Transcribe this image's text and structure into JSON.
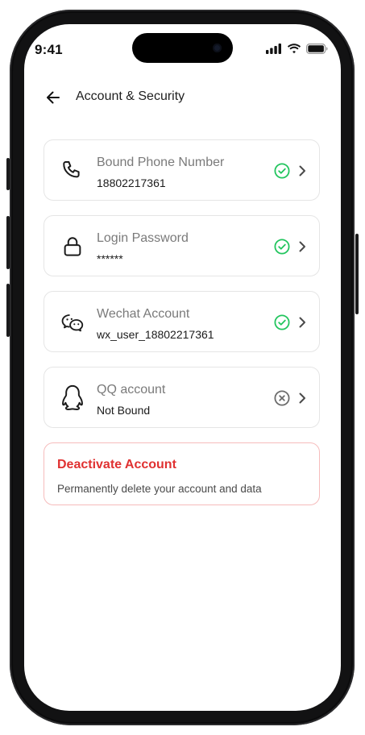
{
  "status_bar": {
    "time": "9:41"
  },
  "header": {
    "back_icon": "arrow-left-icon",
    "title": "Account & Security"
  },
  "items": [
    {
      "icon": "phone-icon",
      "label": "Bound Phone Number",
      "value": "18802217361",
      "status": "verified"
    },
    {
      "icon": "lock-icon",
      "label": "Login Password",
      "value": "******",
      "status": "verified"
    },
    {
      "icon": "wechat-icon",
      "label": "Wechat Account",
      "value": "wx_user_18802217361",
      "status": "verified"
    },
    {
      "icon": "qq-icon",
      "label": "QQ account",
      "value": "Not Bound",
      "status": "unbound"
    }
  ],
  "danger": {
    "title": "Deactivate Account",
    "subtitle": "Permanently delete your account and data"
  },
  "colors": {
    "verified": "#22c55e",
    "unbound": "#6b6b6b",
    "danger": "#e03131",
    "danger_border": "#f6bcbc"
  }
}
